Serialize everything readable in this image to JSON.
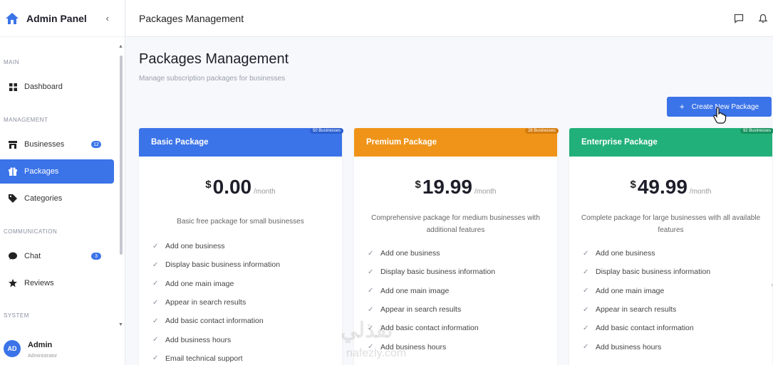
{
  "sidebar": {
    "brand": "Admin Panel",
    "collapse_icon": "‹",
    "sections": {
      "main": "MAIN",
      "management": "MANAGEMENT",
      "communication": "COMMUNICATION",
      "system": "SYSTEM"
    },
    "items": [
      {
        "label": "Dashboard",
        "icon": "grid-icon"
      },
      {
        "label": "Businesses",
        "icon": "store-icon",
        "badge": "12"
      },
      {
        "label": "Packages",
        "icon": "gift-icon",
        "active": true
      },
      {
        "label": "Categories",
        "icon": "tag-icon"
      },
      {
        "label": "Chat",
        "icon": "chat-icon",
        "badge": "3"
      },
      {
        "label": "Reviews",
        "icon": "star-icon"
      }
    ],
    "user": {
      "initials": "AD",
      "name": "Admin",
      "role": "Administrator"
    }
  },
  "topbar": {
    "breadcrumb": "Packages Management"
  },
  "main": {
    "title": "Packages Management",
    "subtitle": "Manage subscription packages for businesses",
    "create_button": "Create New Package",
    "create_icon": "+"
  },
  "packages": [
    {
      "name": "Basic Package",
      "count": "50 Businesses",
      "currency": "$",
      "price": "0.00",
      "period": "/month",
      "color": "#3b73e8",
      "description": "Basic free package for small businesses",
      "features": [
        "Add one business",
        "Display basic business information",
        "Add one main image",
        "Appear in search results",
        "Add basic contact information",
        "Add business hours",
        "Email technical support"
      ]
    },
    {
      "name": "Premium Package",
      "count": "28 Businesses",
      "currency": "$",
      "price": "19.99",
      "period": "/month",
      "color": "#ef9418",
      "description": "Comprehensive package for medium businesses with additional features",
      "features": [
        "Add one business",
        "Display basic business information",
        "Add one main image",
        "Appear in search results",
        "Add basic contact information",
        "Add business hours"
      ]
    },
    {
      "name": "Enterprise Package",
      "count": "92 Businesses",
      "currency": "$",
      "price": "49.99",
      "period": "/month",
      "color": "#21b07a",
      "description": "Complete package for large businesses with all available features",
      "features": [
        "Add one business",
        "Display basic business information",
        "Add one main image",
        "Appear in search results",
        "Add basic contact information",
        "Add business hours"
      ]
    }
  ],
  "watermark": {
    "text": "نفذلي",
    "sub": "nafezly.com"
  }
}
